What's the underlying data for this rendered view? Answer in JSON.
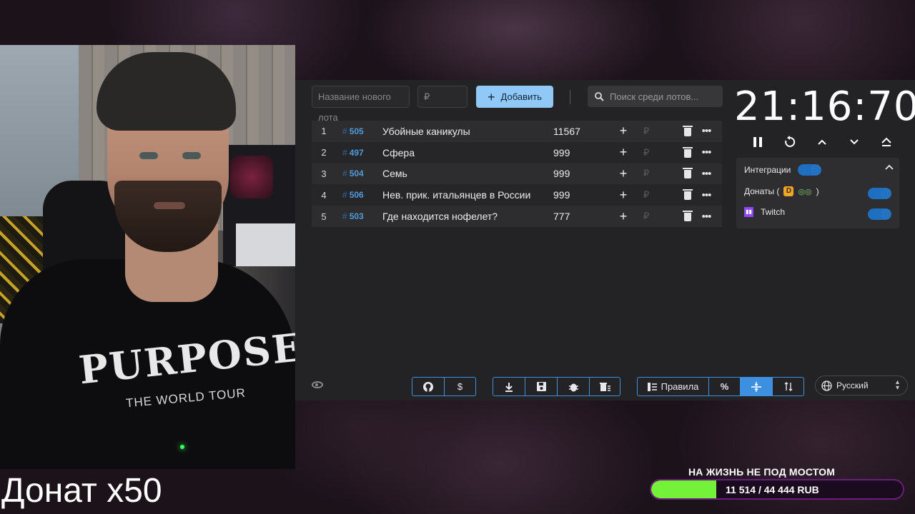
{
  "overlay": {
    "caption": "Донат x50",
    "goal_title": "НА ЖИЗНЬ НЕ ПОД МОСТОМ",
    "goal_text": "11 514 / 44 444 RUB",
    "goal_progress": 0.259
  },
  "webcam": {
    "shirt_text": "PURPOSE",
    "shirt_sub": "THE WORLD TOUR"
  },
  "toolbar": {
    "name_placeholder": "Название нового лота",
    "price_placeholder": "₽",
    "add_label": "Добавить",
    "search_placeholder": "Поиск среди лотов..."
  },
  "lots": [
    {
      "index": "1",
      "id": "505",
      "name": "Убойные каникулы",
      "amount": "11567"
    },
    {
      "index": "2",
      "id": "497",
      "name": "Сфера",
      "amount": "999"
    },
    {
      "index": "3",
      "id": "504",
      "name": "Семь",
      "amount": "999"
    },
    {
      "index": "4",
      "id": "506",
      "name": "Нев. прик. итальянцев в России",
      "amount": "999"
    },
    {
      "index": "5",
      "id": "503",
      "name": "Где находится нофелет?",
      "amount": "777"
    }
  ],
  "timer": {
    "value": "21:16:70"
  },
  "integrations": {
    "header": "Интеграции",
    "donat_label": "Донаты (",
    "donat_close": ")",
    "twitch_label": "Twitch"
  },
  "bottom": {
    "rules_label": "Правила",
    "language": "Русский"
  },
  "colors": {
    "accent": "#3d8fe0",
    "add_button": "#90c8f8",
    "goal_fill": "#74f23a",
    "goal_border": "#6b1d7e"
  }
}
